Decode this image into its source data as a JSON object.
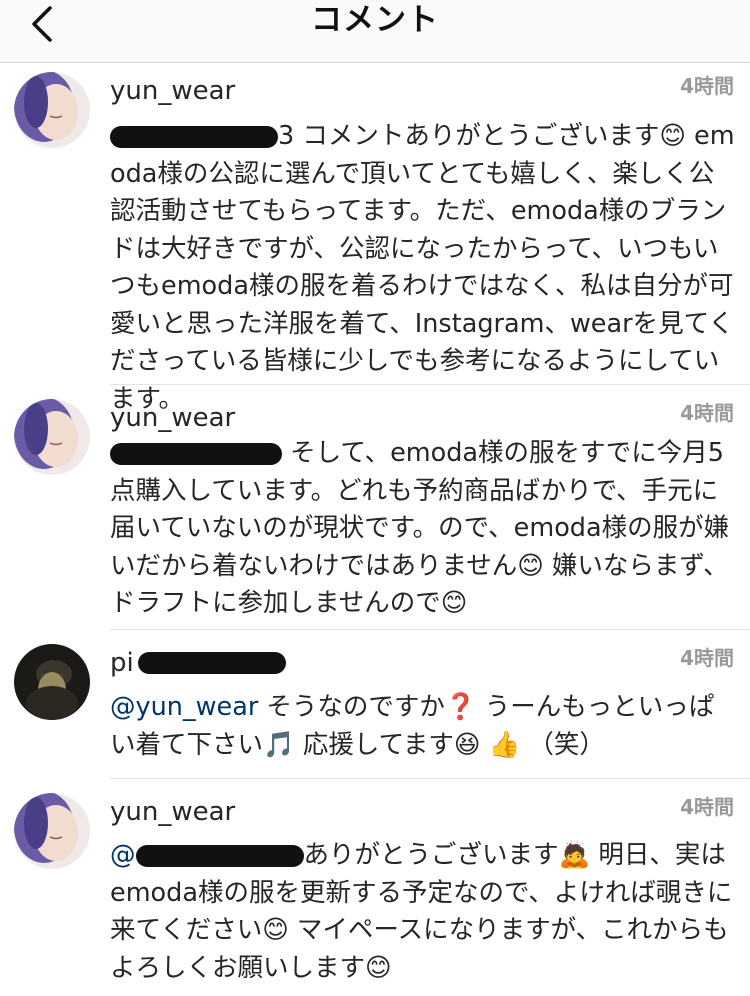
{
  "nav": {
    "title": "コメント",
    "back_icon": "chevron-left-icon"
  },
  "comments": [
    {
      "username": "yun_wear",
      "time": "4時間",
      "avatar": "avatar-purple-hair",
      "redacted_prefix_tail": "3",
      "text": " コメントありがとうございます😊 emoda様の公認に選んで頂いてとても嬉しく、楽しく公認活動させてもらってます。ただ、emoda様のブランドは大好きですが、公認になったからって、いつもいつもemoda様の服を着るわけではなく、私は自分が可愛いと思った洋服を着て、Instagram、wearを見てくださっている皆様に少しでも参考になるようにしています。"
    },
    {
      "username": "yun_wear",
      "time": "4時間",
      "avatar": "avatar-purple-hair",
      "text": " そして、emoda様の服をすでに今月5点購入しています。どれも予約商品ばかりで、手元に届いていないのが現状です。ので、emoda様の服が嫌いだから着ないわけではありません😊 嫌いならまず、ドラフトに参加しませんので😊"
    },
    {
      "username_visible": "pi",
      "time": "4時間",
      "avatar": "avatar-dark-person",
      "mention": "@yun_wear",
      "text": " そうなのですか❓ うーんもっといっぱい着て下さい🎵 応援してます😆 👍 （笑）"
    },
    {
      "username": "yun_wear",
      "time": "4時間",
      "avatar": "avatar-purple-hair",
      "mention_visible": "@",
      "text": "ありがとうございます🙇 明日、実はemoda様の服を更新する予定なので、よければ覗きに来てください😊 マイペースになりますが、これからもよろしくお願いします😊"
    }
  ]
}
